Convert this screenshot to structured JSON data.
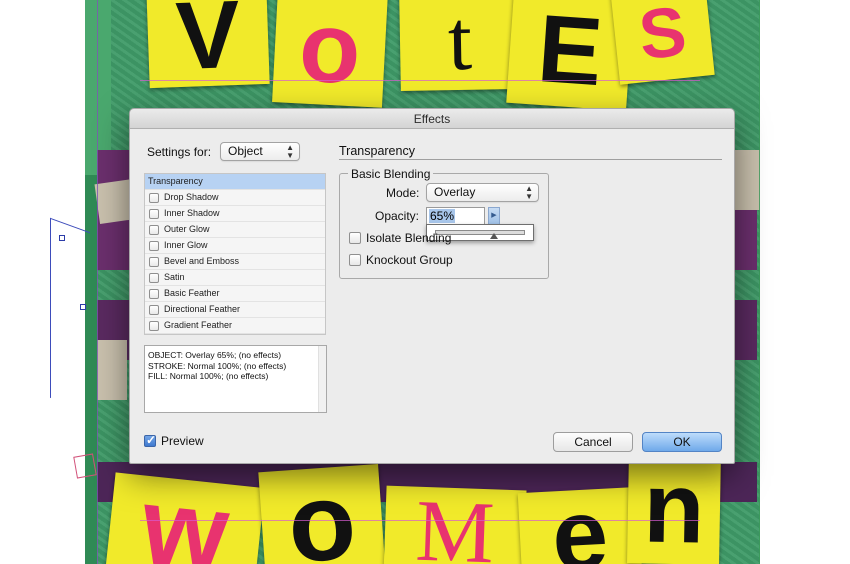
{
  "artwork": {
    "top_letters": [
      "V",
      "o",
      "t",
      "E",
      "S"
    ],
    "bottom_letters": [
      "w",
      "o",
      "M",
      "e",
      "n"
    ],
    "colors": {
      "card": "#f1ea2a",
      "pink": "#e8336f",
      "black": "#111111",
      "green": "#3f9b68",
      "purple": "#6b2f6d"
    }
  },
  "dialog": {
    "title": "Effects",
    "settings_for_label": "Settings for:",
    "settings_for_value": "Object",
    "effects": [
      {
        "label": "Transparency",
        "selected": true
      },
      {
        "label": "Drop Shadow",
        "checked": false
      },
      {
        "label": "Inner Shadow",
        "checked": false
      },
      {
        "label": "Outer Glow",
        "checked": false
      },
      {
        "label": "Inner Glow",
        "checked": false
      },
      {
        "label": "Bevel and Emboss",
        "checked": false
      },
      {
        "label": "Satin",
        "checked": false
      },
      {
        "label": "Basic Feather",
        "checked": false
      },
      {
        "label": "Directional Feather",
        "checked": false
      },
      {
        "label": "Gradient Feather",
        "checked": false
      }
    ],
    "summary_lines": [
      "OBJECT: Overlay 65%; (no effects)",
      "STROKE: Normal 100%; (no effects)",
      "FILL: Normal 100%; (no effects)"
    ],
    "section_title": "Transparency",
    "basic_blending": {
      "group_title": "Basic Blending",
      "mode_label": "Mode:",
      "mode_value": "Overlay",
      "opacity_label": "Opacity:",
      "opacity_value": "65%",
      "opacity_fraction": 0.65,
      "isolate_blending_label": "Isolate Blending",
      "knockout_group_label": "Knockout Group"
    },
    "preview_label": "Preview",
    "preview_checked": true,
    "cancel_label": "Cancel",
    "ok_label": "OK"
  }
}
